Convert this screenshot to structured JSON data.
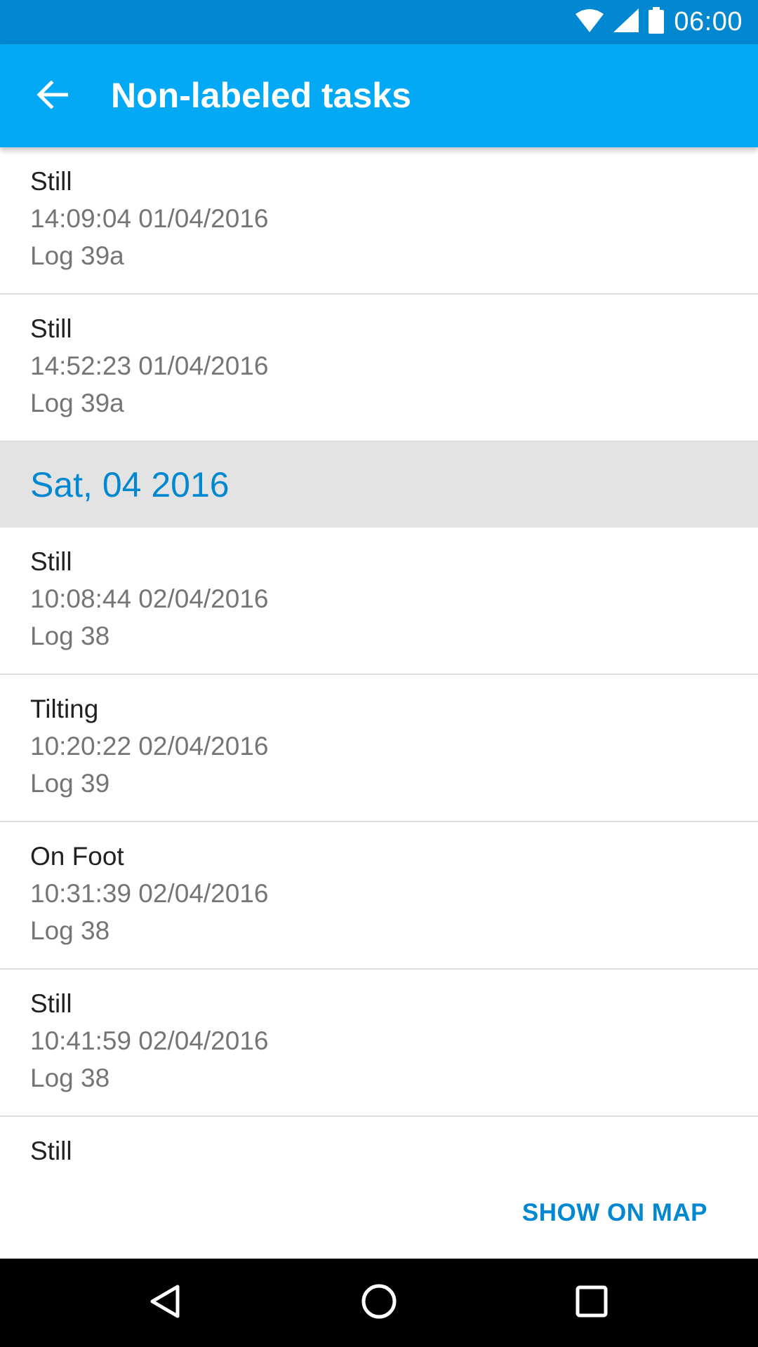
{
  "status_bar": {
    "time": "06:00",
    "icons": [
      "wifi-icon",
      "signal-icon",
      "battery-icon"
    ],
    "background": "#0288d1"
  },
  "app_bar": {
    "title": "Non-labeled tasks",
    "back_icon": "arrow-back-icon",
    "background": "#03a9f4"
  },
  "list": {
    "group_1_items": [
      {
        "activity": "Still",
        "time": "14:09:04 01/04/2016",
        "log": "Log 39a"
      },
      {
        "activity": "Still",
        "time": "14:52:23 01/04/2016",
        "log": "Log 39a"
      }
    ],
    "section_header": "Sat, 04 2016",
    "group_2_items": [
      {
        "activity": "Still",
        "time": "10:08:44 02/04/2016",
        "log": "Log 38"
      },
      {
        "activity": "Tilting",
        "time": "10:20:22 02/04/2016",
        "log": "Log 39"
      },
      {
        "activity": "On Foot",
        "time": "10:31:39 02/04/2016",
        "log": "Log 38"
      },
      {
        "activity": "Still",
        "time": "10:41:59 02/04/2016",
        "log": "Log 38"
      }
    ],
    "partial_item": {
      "activity": "Still"
    }
  },
  "footer": {
    "show_on_map_label": "SHOW ON MAP",
    "accent": "#0288d1"
  },
  "nav_bar": {
    "icons": [
      "back-triangle-icon",
      "home-circle-icon",
      "recents-square-icon"
    ]
  }
}
